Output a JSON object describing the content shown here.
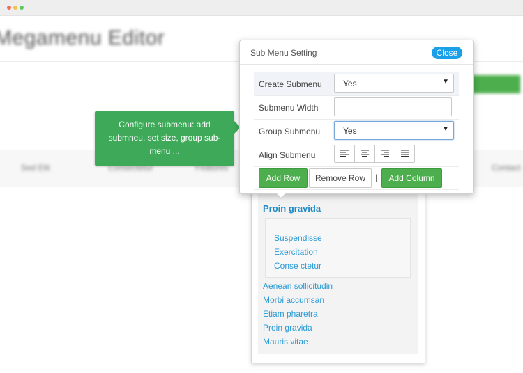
{
  "window": {
    "title_blurred": "Megamenu Editor"
  },
  "background": {
    "menu_items_blurred": [
      "Sed Elit",
      "Consectetur",
      "Features",
      "Contact"
    ]
  },
  "tooltip": {
    "text": "Configure submenu: add submneu, set size, group sub-menu ..."
  },
  "dialog": {
    "title": "Sub Menu Setting",
    "close_label": "Close",
    "rows": [
      {
        "label": "Create Submenu",
        "value": "Yes"
      },
      {
        "label": "Submenu Width",
        "value": ""
      },
      {
        "label": "Group Submenu",
        "value": "Yes"
      },
      {
        "label": "Align Submenu"
      }
    ],
    "align_icons": [
      "align-left-icon",
      "align-center-icon",
      "align-right-icon",
      "align-justify-icon"
    ],
    "buttons": {
      "add_row": "Add Row",
      "remove_row": "Remove Row",
      "separator": "|",
      "add_column": "Add Column"
    }
  },
  "submenu": {
    "heading": "Proin gravida",
    "group_items": [
      "Suspendisse",
      "Exercitation",
      "Conse ctetur"
    ],
    "items": [
      "Aenean sollicitudin",
      "Morbi accumsan",
      "Etiam pharetra",
      "Proin gravida",
      "Mauris vitae"
    ]
  },
  "colors": {
    "accent_green": "#4cae4c",
    "tooltip_green": "#3eaa59",
    "close_blue": "#1aa0e8",
    "link_blue": "#2a9bd6"
  }
}
